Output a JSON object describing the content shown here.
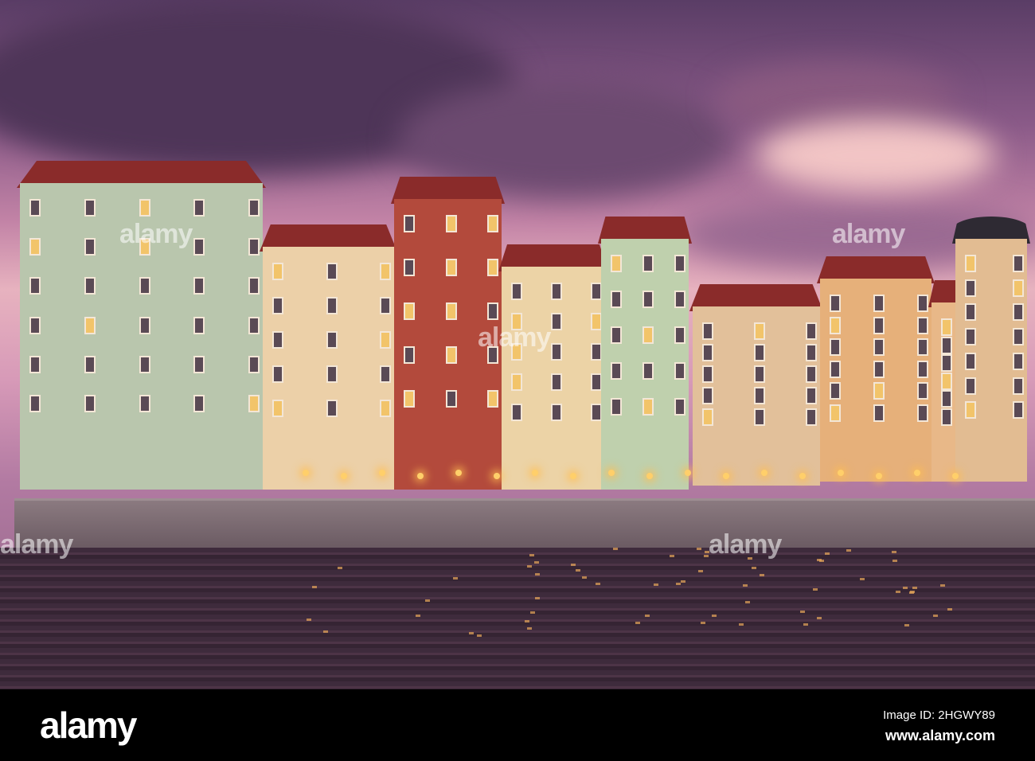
{
  "photo": {
    "description_alt": "alamy",
    "watermark": "alamy"
  },
  "footer": {
    "logo": "alamy",
    "image_id": "Image ID: 2HGWY89",
    "url": "www.alamy.com"
  },
  "colors": {
    "sky": "#c283a6",
    "roof": "#8a2b2a",
    "water": "#3e2b3c"
  }
}
